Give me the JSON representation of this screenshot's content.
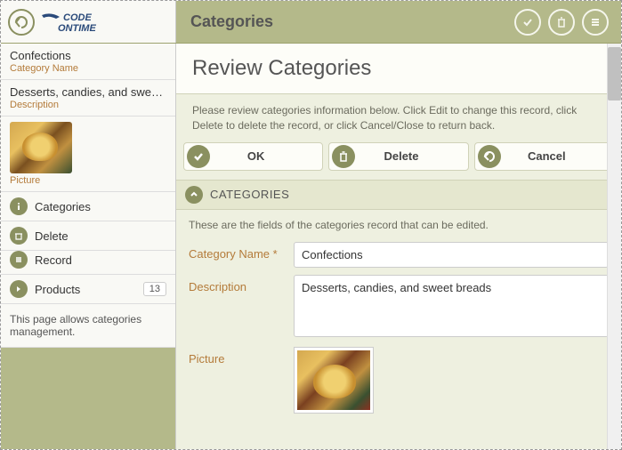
{
  "header": {
    "title": "Categories",
    "logo_top": "CODE",
    "logo_bottom": "ONTIME"
  },
  "sidebar": {
    "category_name": {
      "value": "Confections",
      "label": "Category Name"
    },
    "description": {
      "value": "Desserts, candies, and sweet...",
      "label": "Description"
    },
    "picture": {
      "label": "Picture"
    },
    "items": [
      {
        "label": "Categories",
        "icon": "info"
      },
      {
        "label": "Delete",
        "icon": "trash"
      },
      {
        "label": "Record",
        "icon": "menu"
      },
      {
        "label": "Products",
        "icon": "arrow",
        "badge": "13"
      }
    ],
    "help": "This page allows categories management."
  },
  "main": {
    "title": "Review Categories",
    "instructions": "Please review categories information below. Click Edit to change this record, click Delete to delete the record, or click Cancel/Close to return back.",
    "buttons": {
      "ok": "OK",
      "delete": "Delete",
      "cancel": "Cancel"
    },
    "section": {
      "title": "CATEGORIES",
      "desc": "These are the fields of the categories record that can be edited."
    },
    "fields": {
      "category_name": {
        "label": "Category Name *",
        "value": "Confections"
      },
      "description": {
        "label": "Description",
        "value": "Desserts, candies, and sweet breads"
      },
      "picture": {
        "label": "Picture"
      }
    }
  }
}
